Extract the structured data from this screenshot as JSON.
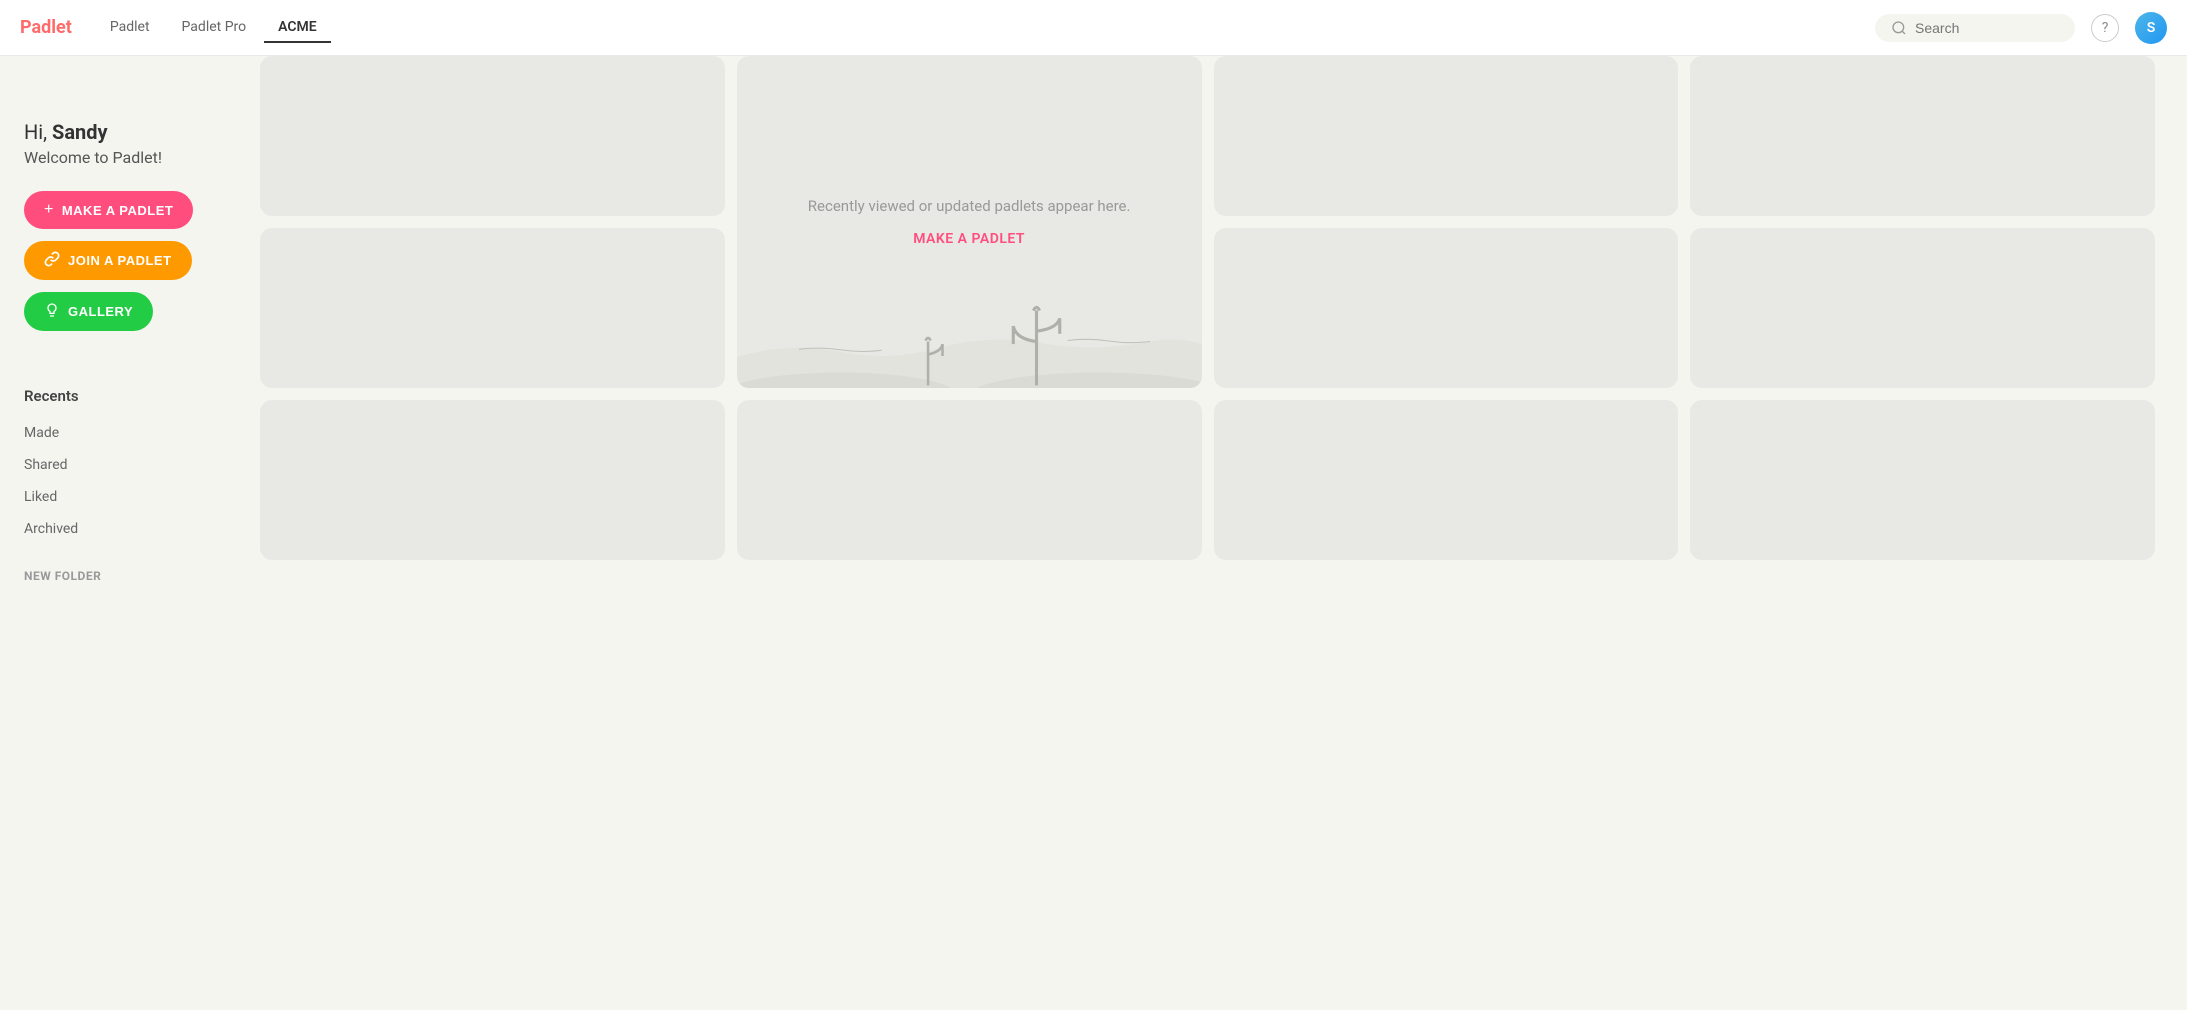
{
  "nav": {
    "logo": "Padlet",
    "tabs": [
      {
        "id": "padlet",
        "label": "Padlet"
      },
      {
        "id": "padlet-pro",
        "label": "Padlet Pro"
      },
      {
        "id": "acme",
        "label": "ACME",
        "active": true
      }
    ],
    "search_placeholder": "Search",
    "help_label": "?",
    "user_initials": "S"
  },
  "welcome": {
    "greeting": "Hi, ",
    "name": "Sandy",
    "subtitle": "Welcome to Padlet!"
  },
  "buttons": {
    "make_padlet": "MAKE A PADLET",
    "join_padlet": "JOIN A PADLET",
    "gallery": "GALLERY"
  },
  "sidebar": {
    "section_title": "Recents",
    "items": [
      {
        "label": "Made"
      },
      {
        "label": "Shared"
      },
      {
        "label": "Liked"
      },
      {
        "label": "Archived"
      }
    ],
    "new_folder": "NEW FOLDER"
  },
  "main": {
    "empty_message": "Recently viewed or updated padlets appear here.",
    "make_padlet_link": "MAKE A PADLET"
  },
  "icons": {
    "plus": "+",
    "link": "🔗",
    "lightbulb": "💡",
    "search": "search"
  }
}
